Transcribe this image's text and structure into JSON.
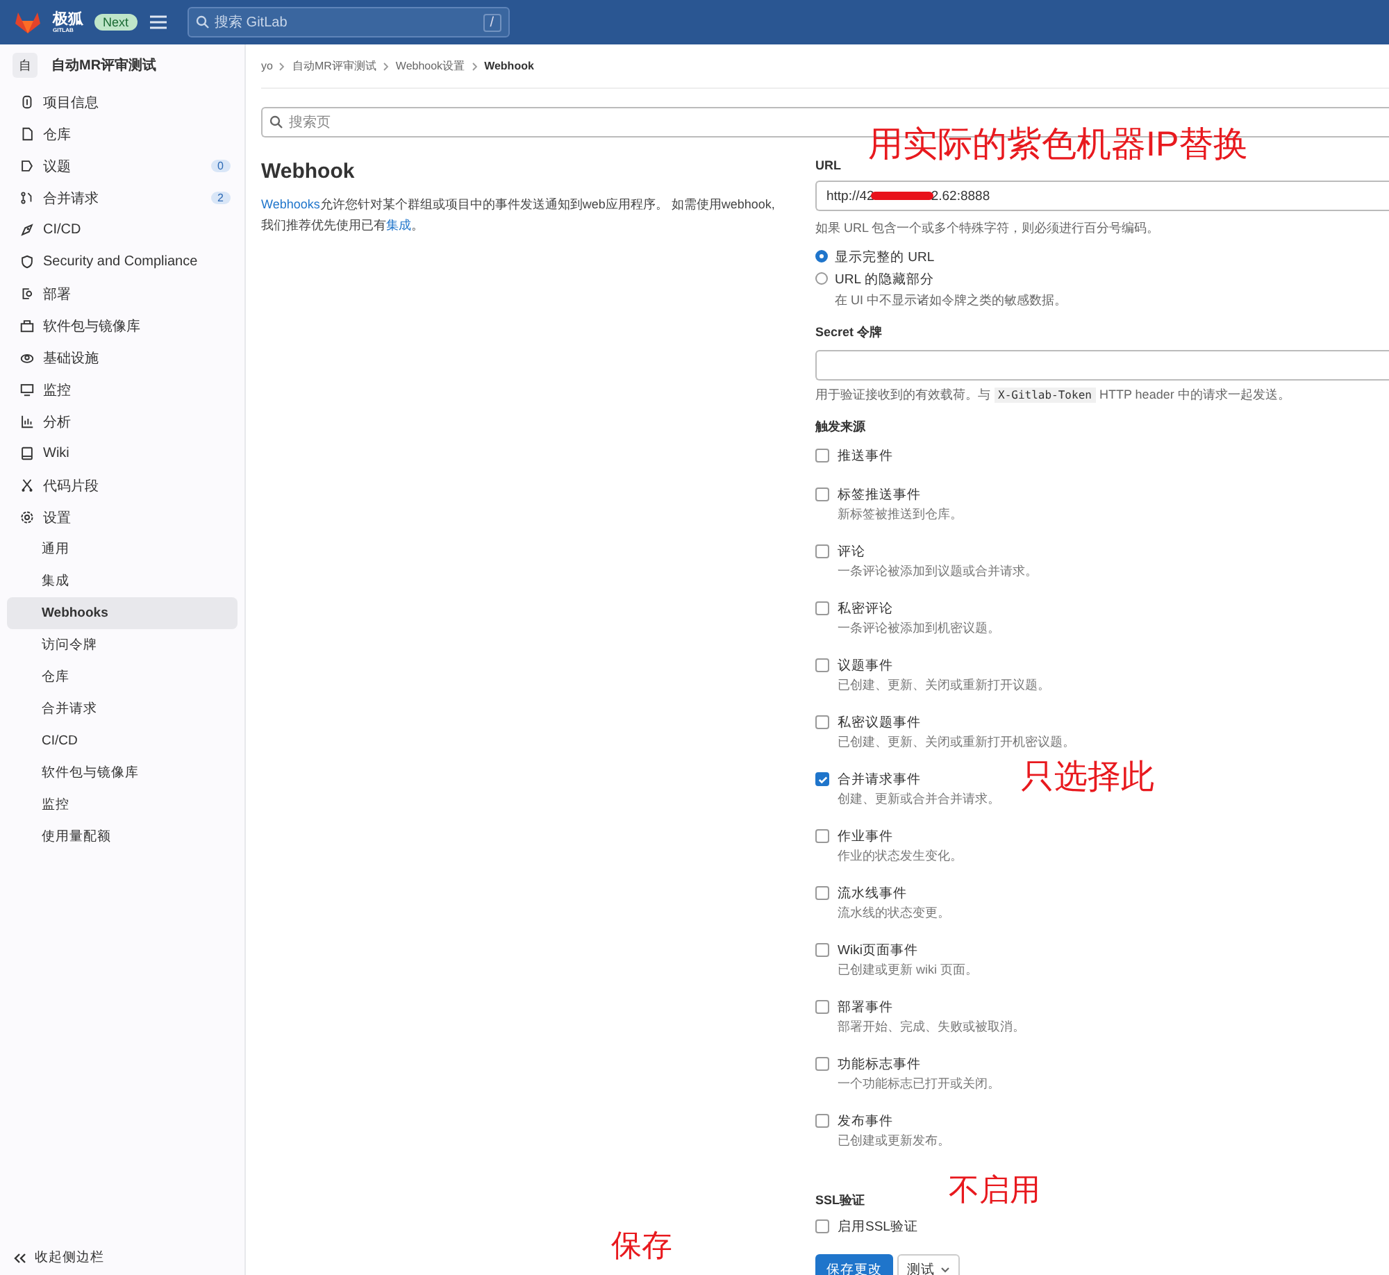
{
  "topbar": {
    "brand": "极狐",
    "brand_sub": "GITLAB",
    "badge": "Next",
    "search": {
      "placeholder": "搜索 GitLab",
      "shortcut": "/"
    }
  },
  "sidebar": {
    "project_avatar": "自",
    "project_name": "自动MR评审测试",
    "items": [
      {
        "label": "项目信息"
      },
      {
        "label": "仓库"
      },
      {
        "label": "议题",
        "count": "0"
      },
      {
        "label": "合并请求",
        "count": "2"
      },
      {
        "label": "CI/CD"
      },
      {
        "label": "Security and Compliance"
      },
      {
        "label": "部署"
      },
      {
        "label": "软件包与镜像库"
      },
      {
        "label": "基础设施"
      },
      {
        "label": "监控"
      },
      {
        "label": "分析"
      },
      {
        "label": "Wiki"
      },
      {
        "label": "代码片段"
      },
      {
        "label": "设置",
        "children": [
          {
            "label": "通用",
            "selected": false
          },
          {
            "label": "集成",
            "selected": false
          },
          {
            "label": "Webhooks",
            "selected": true
          },
          {
            "label": "访问令牌",
            "selected": false
          },
          {
            "label": "仓库",
            "selected": false
          },
          {
            "label": "合并请求",
            "selected": false
          },
          {
            "label": "CI/CD",
            "selected": false
          },
          {
            "label": "软件包与镜像库",
            "selected": false
          },
          {
            "label": "监控",
            "selected": false
          },
          {
            "label": "使用量配额",
            "selected": false
          }
        ]
      }
    ],
    "collapse": "收起侧边栏"
  },
  "breadcrumb": [
    "yo",
    "自动MR评审测试",
    "Webhook设置",
    "Webhook"
  ],
  "page_search": {
    "placeholder": "搜索页"
  },
  "intro": {
    "title": "Webhook",
    "link": "Webhooks",
    "text": "允许您针对某个群组或项目中的事件发送通知到web应用程序。 如需使用webhook, 我们推荐优先使用已有",
    "link2": "集成",
    "end": "。"
  },
  "form": {
    "url_label": "URL",
    "url_value_start": "http://42",
    "url_value_end": "2.62:8888",
    "url_help": "如果 URL 包含一个或多个特殊字符，则必须进行百分号编码。",
    "url_modes": [
      {
        "label": "显示完整的 URL",
        "selected": true
      },
      {
        "label": "URL 的隐藏部分",
        "hint": "在 UI 中不显示诸如令牌之类的敏感数据。",
        "selected": false
      }
    ],
    "secret_label": "Secret 令牌",
    "secret_help_start": "用于验证接收到的有效载荷。与",
    "secret_help_code": "X-Gitlab-Token",
    "secret_help_end": "HTTP header 中的请求一起发送。",
    "triggers_label": "触发来源",
    "triggers": [
      {
        "label": "推送事件",
        "checked": false
      },
      {
        "label": "标签推送事件",
        "desc": "新标签被推送到仓库。",
        "checked": false
      },
      {
        "label": "评论",
        "desc": "一条评论被添加到议题或合并请求。",
        "checked": false
      },
      {
        "label": "私密评论",
        "desc": "一条评论被添加到机密议题。",
        "checked": false
      },
      {
        "label": "议题事件",
        "desc": "已创建、更新、关闭或重新打开议题。",
        "checked": false
      },
      {
        "label": "私密议题事件",
        "desc": "已创建、更新、关闭或重新打开机密议题。",
        "checked": false
      },
      {
        "label": "合并请求事件",
        "desc": "创建、更新或合并合并请求。",
        "checked": true
      },
      {
        "label": "作业事件",
        "desc": "作业的状态发生变化。",
        "checked": false
      },
      {
        "label": "流水线事件",
        "desc": "流水线的状态变更。",
        "checked": false
      },
      {
        "label": "Wiki页面事件",
        "desc": "已创建或更新 wiki 页面。",
        "checked": false
      },
      {
        "label": "部署事件",
        "desc": "部署开始、完成、失败或被取消。",
        "checked": false
      },
      {
        "label": "功能标志事件",
        "desc": "一个功能标志已打开或关闭。",
        "checked": false
      },
      {
        "label": "发布事件",
        "desc": "已创建或更新发布。",
        "checked": false
      }
    ],
    "ssl_label": "SSL验证",
    "ssl": {
      "label": "启用SSL验证",
      "checked": false
    },
    "save": "保存更改",
    "test": "测试"
  },
  "annotations": [
    {
      "text": "用实际的紫色机器IP替换"
    },
    {
      "text": "只选择此"
    },
    {
      "text": "不启用"
    },
    {
      "text": "保存"
    }
  ]
}
